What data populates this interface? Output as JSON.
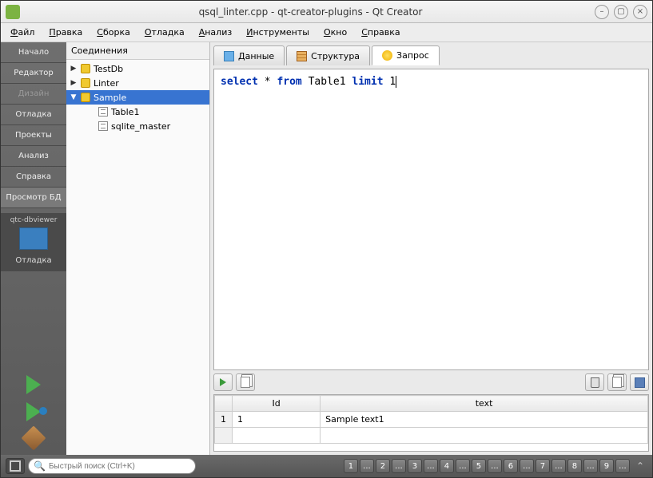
{
  "window": {
    "title": "qsql_linter.cpp - qt-creator-plugins - Qt Creator"
  },
  "menubar": [
    "Файл",
    "Правка",
    "Сборка",
    "Отладка",
    "Анализ",
    "Инструменты",
    "Окно",
    "Справка"
  ],
  "sidebar": {
    "modes": [
      {
        "label": "Начало",
        "state": ""
      },
      {
        "label": "Редактор",
        "state": ""
      },
      {
        "label": "Дизайн",
        "state": "disabled"
      },
      {
        "label": "Отладка",
        "state": ""
      },
      {
        "label": "Проекты",
        "state": ""
      },
      {
        "label": "Анализ",
        "state": ""
      },
      {
        "label": "Справка",
        "state": ""
      },
      {
        "label": "Просмотр БД",
        "state": "selected"
      }
    ],
    "project": "qtc-dbviewer",
    "task": "Отладка"
  },
  "tree": {
    "header": "Соединения",
    "items": [
      {
        "type": "db",
        "label": "TestDb",
        "expanded": false,
        "indent": 0
      },
      {
        "type": "db",
        "label": "Linter",
        "expanded": false,
        "indent": 0
      },
      {
        "type": "db",
        "label": "Sample",
        "expanded": true,
        "indent": 0,
        "selected": true
      },
      {
        "type": "tbl",
        "label": "Table1",
        "indent": 2
      },
      {
        "type": "tbl",
        "label": "sqlite_master",
        "indent": 2
      }
    ]
  },
  "tabs": [
    {
      "label": "Данные",
      "icon": "data"
    },
    {
      "label": "Структура",
      "icon": "struct"
    },
    {
      "label": "Запрос",
      "icon": "query",
      "active": true
    }
  ],
  "editor": {
    "tokens": [
      {
        "t": "select",
        "kw": true
      },
      {
        "t": " * "
      },
      {
        "t": "from",
        "kw": true
      },
      {
        "t": " Table1 "
      },
      {
        "t": "limit",
        "kw": true
      },
      {
        "t": " 1"
      }
    ]
  },
  "result": {
    "columns": [
      "Id",
      "text"
    ],
    "rows": [
      {
        "n": "1",
        "cells": [
          "1",
          "Sample text1"
        ]
      }
    ]
  },
  "statusbar": {
    "search_placeholder": "Быстрый поиск (Ctrl+K)",
    "panes": [
      "1",
      "...",
      "2",
      "...",
      "3",
      "...",
      "4",
      "...",
      "5",
      "...",
      "6",
      "...",
      "7",
      "...",
      "8",
      "...",
      "9",
      "..."
    ]
  }
}
